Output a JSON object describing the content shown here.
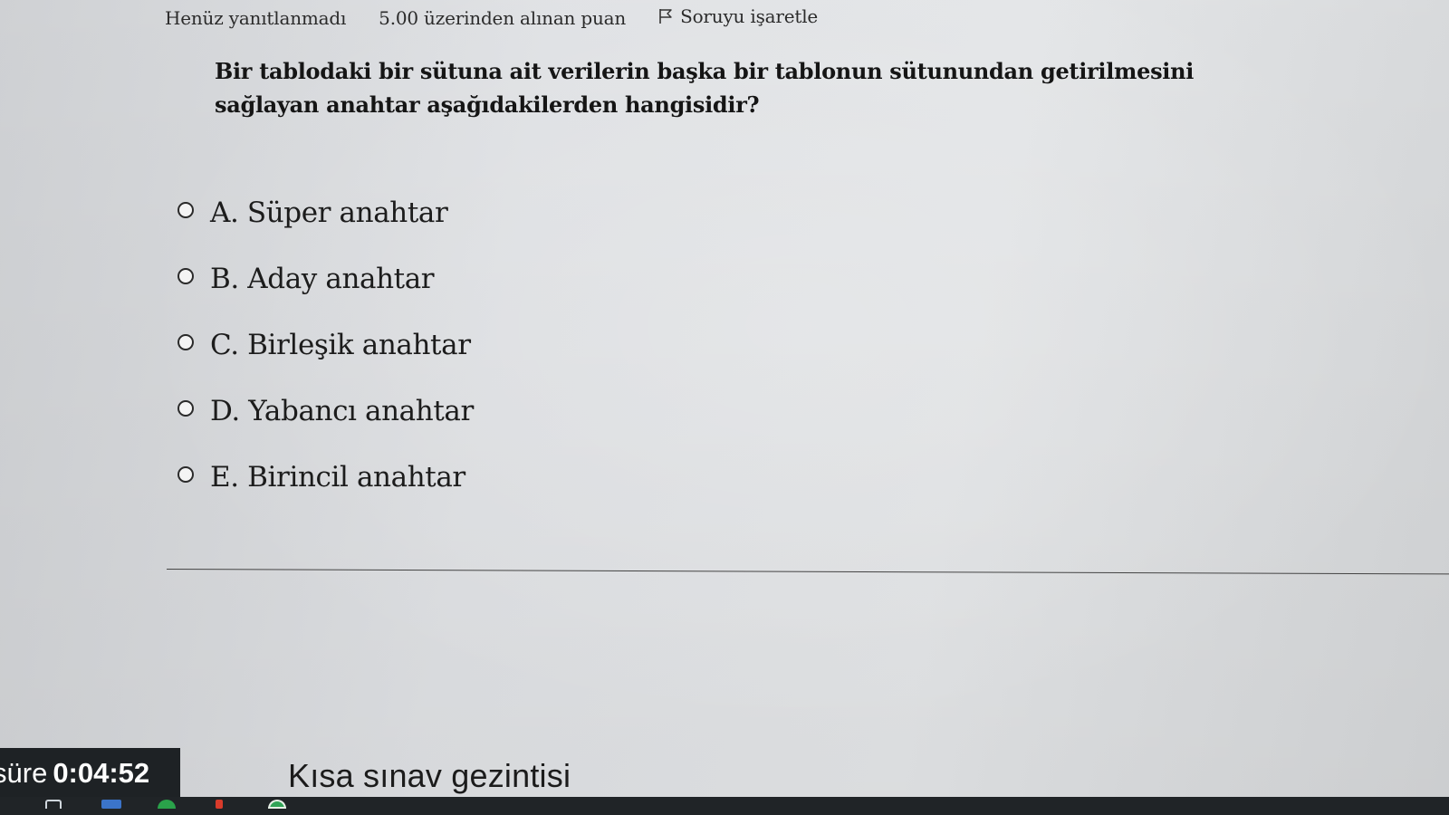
{
  "question_info": {
    "state": "Henüz yanıtlanmadı",
    "grade": "5.00 üzerinden alınan puan",
    "flag_label": "Soruyu işaretle"
  },
  "question": {
    "text": "Bir tablodaki bir sütuna ait verilerin başka bir tablonun sütunundan getirilmesini sağlayan anahtar aşağıdakilerden hangisidir?"
  },
  "answers": [
    {
      "label": "A. Süper anahtar"
    },
    {
      "label": "B. Aday anahtar"
    },
    {
      "label": "C. Birleşik anahtar"
    },
    {
      "label": "D. Yabancı anahtar"
    },
    {
      "label": "E. Birincil anahtar"
    }
  ],
  "timer": {
    "label": "süre",
    "value": "0:04:52"
  },
  "navigation": {
    "title": "Kısa sınav gezintisi"
  },
  "icons": {
    "flag": "flag-icon",
    "taskbar": [
      "file-explorer-icon",
      "mail-icon",
      "browser-icon",
      "pdf-icon",
      "chrome-icon"
    ]
  }
}
